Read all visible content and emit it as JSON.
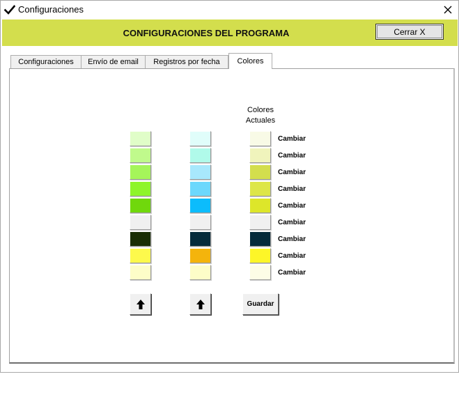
{
  "window": {
    "title": "Configuraciones"
  },
  "header": {
    "title": "CONFIGURACIONES DEL PROGRAMA",
    "close_label": "Cerrar  X"
  },
  "tabs": [
    {
      "label": "Configuraciones"
    },
    {
      "label": "Envío de email"
    },
    {
      "label": "Registros por fecha"
    },
    {
      "label": "Colores",
      "active": true
    }
  ],
  "colors_panel": {
    "header_line1": "Colores",
    "header_line2": "Actuales",
    "change_label": "Cambiar",
    "save_label": "Guardar",
    "palette_a": [
      "#e0fdc8",
      "#c0fa8c",
      "#a5f55a",
      "#8ef52a",
      "#70d80c",
      "#f0f0f0",
      "#1a2e05",
      "#fdf94c",
      "#fdfdc8"
    ],
    "palette_b": [
      "#e0fdfa",
      "#b0faea",
      "#a8e8fc",
      "#6cd8fc",
      "#0cbcfc",
      "#f0f0f0",
      "#052a3a",
      "#f4b40c",
      "#fdfdc8"
    ],
    "current": [
      "#f8fae6",
      "#f0f4bc",
      "#d3de4d",
      "#dde648",
      "#dde62a",
      "#f0f0f0",
      "#052a3a",
      "#fdf628",
      "#fdfde6"
    ]
  },
  "colors": {
    "header_band": "#d3de4d"
  }
}
